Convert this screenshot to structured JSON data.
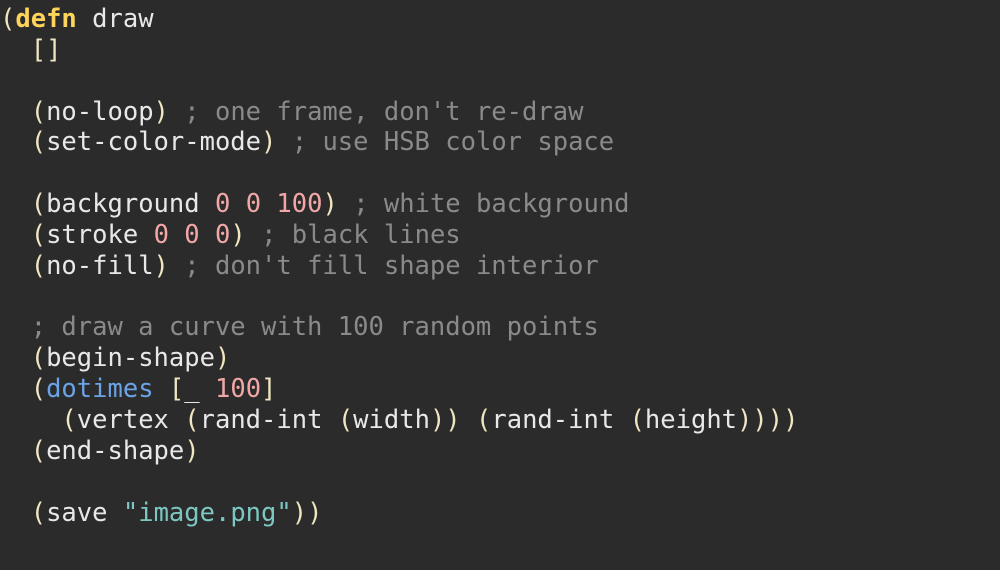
{
  "tokens": {
    "defn": "defn",
    "draw": "draw",
    "no_loop": "no-loop",
    "set_color_mode": "set-color-mode",
    "background": "background",
    "stroke": "stroke",
    "no_fill": "no-fill",
    "begin_shape": "begin-shape",
    "dotimes": "dotimes",
    "underscore": "_",
    "vertex": "vertex",
    "rand_int": "rand-int",
    "width": "width",
    "height": "height",
    "end_shape": "end-shape",
    "save": "save"
  },
  "numbers": {
    "zero": "0",
    "hundred": "100"
  },
  "strings": {
    "image_png": "\"image.png\""
  },
  "comments": {
    "one_frame": "; one frame, don't re-draw",
    "hsb": "; use HSB color space",
    "white_bg": "; white background",
    "black_lines": "; black lines",
    "no_fill": "; don't fill shape interior",
    "curve": "; draw a curve with 100 random points"
  },
  "punct": {
    "open_paren": "(",
    "close_paren": ")",
    "open_bracket": "[",
    "close_bracket": "]",
    "empty_vec": "[]",
    "close4": "))))",
    "close2": "))"
  }
}
